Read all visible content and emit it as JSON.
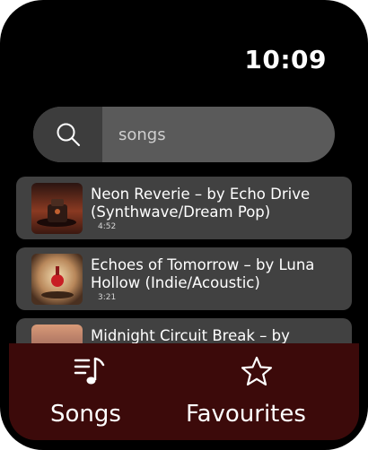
{
  "status": {
    "time": "10:09"
  },
  "search": {
    "query": "songs",
    "icon": "search-icon"
  },
  "songs": [
    {
      "title": "Neon Reverie – by Echo Drive (Synthwave/Dream Pop)",
      "duration": "4:52"
    },
    {
      "title": "Echoes of Tomorrow – by Luna Hollow (Indie/Acoustic)",
      "duration": "3:21"
    },
    {
      "title": "Midnight Circuit Break – by",
      "duration": ""
    }
  ],
  "tabs": [
    {
      "label": "Songs",
      "icon": "music-note-list-icon"
    },
    {
      "label": "Favourites",
      "icon": "star-icon"
    }
  ],
  "colors": {
    "background": "#000000",
    "card": "#414141",
    "search_bar": "#5a5a5a",
    "search_button": "#3d3d3d",
    "tab_bar": "#3c0a0a"
  }
}
